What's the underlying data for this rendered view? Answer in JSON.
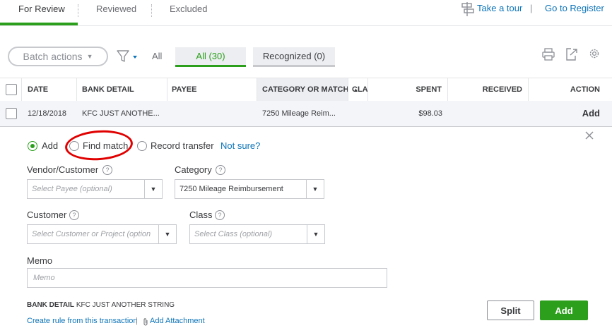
{
  "tabs": [
    "For Review",
    "Reviewed",
    "Excluded"
  ],
  "header_links": {
    "tour": "Take a tour",
    "separator": "|",
    "register": "Go to Register"
  },
  "toolbar": {
    "batch_actions": "Batch actions",
    "filter_all": "All",
    "pill_all": "All (30)",
    "pill_recognized": "Recognized (0)"
  },
  "table": {
    "columns": [
      "DATE",
      "BANK DETAIL",
      "PAYEE",
      "CATEGORY OR MATCH",
      "CLA",
      "SPENT",
      "RECEIVED",
      "ACTION"
    ],
    "sort_indicator": "▲",
    "rows": [
      {
        "date": "12/18/2018",
        "bank_detail": "KFC JUST ANOTHE...",
        "payee": "",
        "category": "7250 Mileage Reim...",
        "class": "",
        "spent": "$98.03",
        "received": "",
        "action": "Add"
      }
    ]
  },
  "detail": {
    "radios": {
      "add": "Add",
      "find_match": "Find match",
      "record_transfer": "Record transfer"
    },
    "selected_radio": "add",
    "not_sure": "Not sure?",
    "fields": {
      "vendor_label": "Vendor/Customer",
      "vendor_placeholder": "Select Payee (optional)",
      "category_label": "Category",
      "category_value": "7250 Mileage Reimbursement",
      "customer_label": "Customer",
      "customer_placeholder": "Select Customer or Project (option",
      "class_label": "Class",
      "class_placeholder": "Select Class (optional)",
      "memo_label": "Memo",
      "memo_placeholder": "Memo"
    },
    "bank_detail_label": "BANK DETAIL",
    "bank_detail_value": "KFC JUST ANOTHER STRING",
    "create_rule": "Create rule from this transaction",
    "footer_separator": "|",
    "add_attachment": "Add Attachment",
    "split_button": "Split",
    "add_button": "Add"
  },
  "icons": {
    "tour": "tour-signpost-icon",
    "filter": "filter-funnel-icon",
    "print": "print-icon",
    "export": "export-icon",
    "settings": "gear-icon",
    "close": "close-icon",
    "attachment": "paperclip-icon",
    "help": "help-icon"
  },
  "colors": {
    "accent_green": "#2ca01c",
    "link_blue": "#0d74b8",
    "annotation_red": "#e00000"
  }
}
